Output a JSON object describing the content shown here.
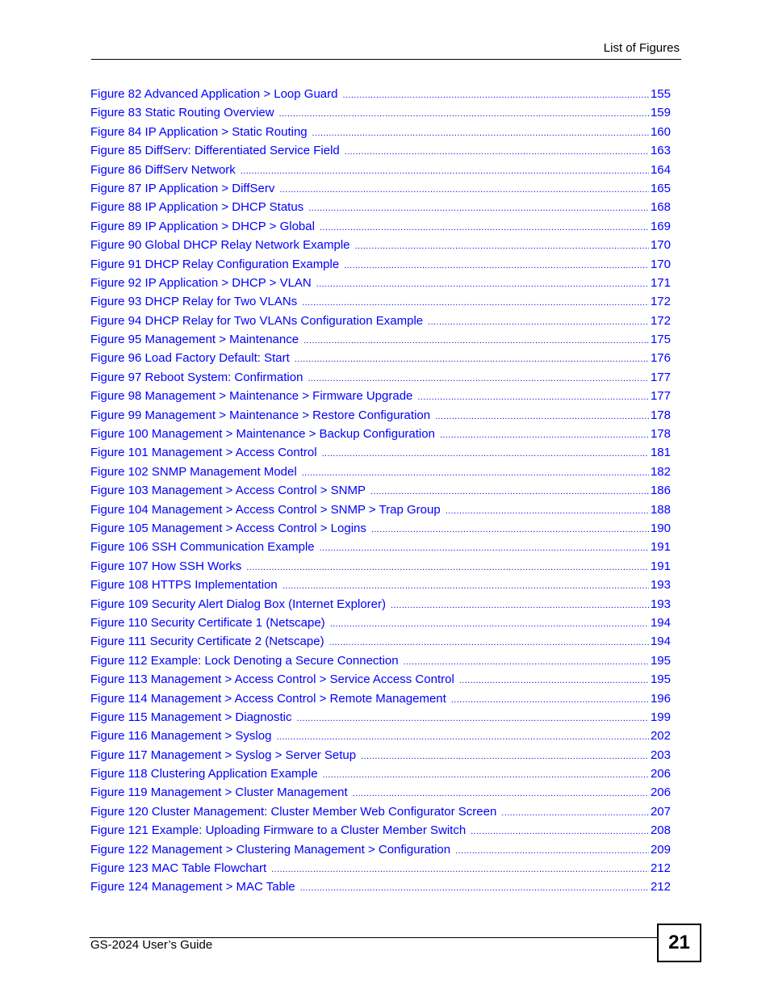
{
  "header": {
    "title": "List of Figures"
  },
  "colors": {
    "link": "#0000ff",
    "text": "#000000"
  },
  "entries": [
    {
      "label": "Figure 82 Advanced Application > Loop Guard",
      "page": "155"
    },
    {
      "label": "Figure 83 Static Routing Overview",
      "page": "159"
    },
    {
      "label": "Figure 84 IP Application > Static Routing",
      "page": "160"
    },
    {
      "label": "Figure 85 DiffServ: Differentiated Service Field",
      "page": "163"
    },
    {
      "label": "Figure 86 DiffServ Network",
      "page": "164"
    },
    {
      "label": "Figure 87 IP Application > DiffServ",
      "page": "165"
    },
    {
      "label": "Figure 88 IP Application > DHCP Status",
      "page": "168"
    },
    {
      "label": "Figure 89 IP Application > DHCP > Global",
      "page": "169"
    },
    {
      "label": "Figure 90 Global DHCP Relay Network Example",
      "page": "170"
    },
    {
      "label": "Figure 91 DHCP Relay Configuration Example",
      "page": "170"
    },
    {
      "label": "Figure 92 IP Application > DHCP > VLAN",
      "page": "171"
    },
    {
      "label": "Figure 93 DHCP Relay for Two VLANs",
      "page": "172"
    },
    {
      "label": "Figure 94 DHCP Relay for Two VLANs Configuration Example",
      "page": "172"
    },
    {
      "label": "Figure 95 Management > Maintenance",
      "page": "175"
    },
    {
      "label": "Figure 96 Load Factory Default: Start",
      "page": "176"
    },
    {
      "label": "Figure 97 Reboot System: Confirmation",
      "page": "177"
    },
    {
      "label": "Figure 98 Management > Maintenance > Firmware Upgrade",
      "page": "177"
    },
    {
      "label": "Figure 99 Management > Maintenance > Restore Configuration",
      "page": "178"
    },
    {
      "label": "Figure 100 Management > Maintenance > Backup Configuration",
      "page": "178"
    },
    {
      "label": "Figure 101 Management > Access Control",
      "page": "181"
    },
    {
      "label": "Figure 102 SNMP Management Model",
      "page": "182"
    },
    {
      "label": "Figure 103 Management > Access Control > SNMP",
      "page": "186"
    },
    {
      "label": "Figure 104 Management > Access Control > SNMP > Trap Group",
      "page": "188"
    },
    {
      "label": "Figure 105 Management > Access Control > Logins",
      "page": "190"
    },
    {
      "label": "Figure 106 SSH Communication Example",
      "page": "191"
    },
    {
      "label": "Figure 107 How SSH Works",
      "page": "191"
    },
    {
      "label": "Figure 108 HTTPS Implementation",
      "page": "193"
    },
    {
      "label": "Figure 109 Security Alert Dialog Box (Internet Explorer)",
      "page": "193"
    },
    {
      "label": "Figure 110 Security Certificate 1 (Netscape)",
      "page": "194"
    },
    {
      "label": "Figure 111 Security Certificate 2 (Netscape)",
      "page": "194"
    },
    {
      "label": "Figure 112 Example: Lock Denoting a Secure Connection",
      "page": "195"
    },
    {
      "label": "Figure 113 Management > Access Control > Service Access Control",
      "page": "195"
    },
    {
      "label": "Figure 114 Management > Access Control > Remote Management",
      "page": "196"
    },
    {
      "label": "Figure 115 Management > Diagnostic",
      "page": "199"
    },
    {
      "label": "Figure 116 Management > Syslog",
      "page": "202"
    },
    {
      "label": "Figure 117 Management > Syslog > Server Setup",
      "page": "203"
    },
    {
      "label": "Figure 118 Clustering Application Example",
      "page": "206"
    },
    {
      "label": "Figure 119 Management > Cluster Management",
      "page": "206"
    },
    {
      "label": "Figure 120 Cluster Management: Cluster Member Web Configurator Screen",
      "page": "207"
    },
    {
      "label": "Figure 121 Example: Uploading Firmware to a Cluster Member Switch",
      "page": "208"
    },
    {
      "label": "Figure 122 Management > Clustering Management > Configuration",
      "page": "209"
    },
    {
      "label": "Figure 123 MAC Table Flowchart",
      "page": "212"
    },
    {
      "label": "Figure 124 Management > MAC Table",
      "page": "212"
    }
  ],
  "footer": {
    "title": "GS-2024 User’s Guide",
    "page_number": "21"
  }
}
